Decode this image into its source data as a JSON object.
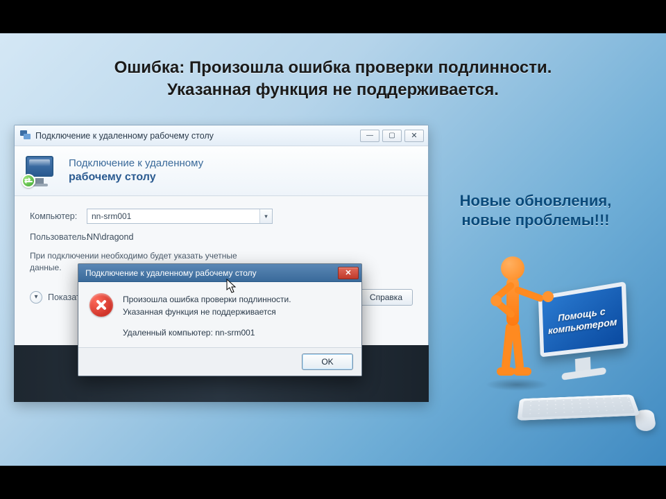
{
  "headline": {
    "line1": "Ошибка: Произошла ошибка проверки подлинности.",
    "line2": "Указанная функция не поддерживается."
  },
  "rdp_window": {
    "title": "Подключение к удаленному рабочему столу",
    "header_line1": "Подключение к удаленному",
    "header_line2": "рабочему столу",
    "labels": {
      "computer": "Компьютер:",
      "user": "Пользователь:"
    },
    "values": {
      "computer": "nn-srm001",
      "user": "NN\\dragond"
    },
    "hint_line1": "При подключении необходимо будет указать учетные",
    "hint_line2": "данные.",
    "options_label": "Показать параметры",
    "help_button": "Справка",
    "window_buttons": {
      "minimize": "—",
      "maximize": "▢",
      "close": "✕"
    }
  },
  "error_dialog": {
    "title": "Подключение к удаленному рабочему столу",
    "line1": "Произошла ошибка проверки подлинности.",
    "line2": "Указанная функция не поддерживается",
    "line3": "Удаленный компьютер: nn-srm001",
    "ok": "OK",
    "close_glyph": "✕"
  },
  "promo": {
    "line1": "Новые обновления,",
    "line2": "новые проблемы!!!",
    "monitor_line1": "Помощь с",
    "monitor_line2": "компьютером"
  }
}
